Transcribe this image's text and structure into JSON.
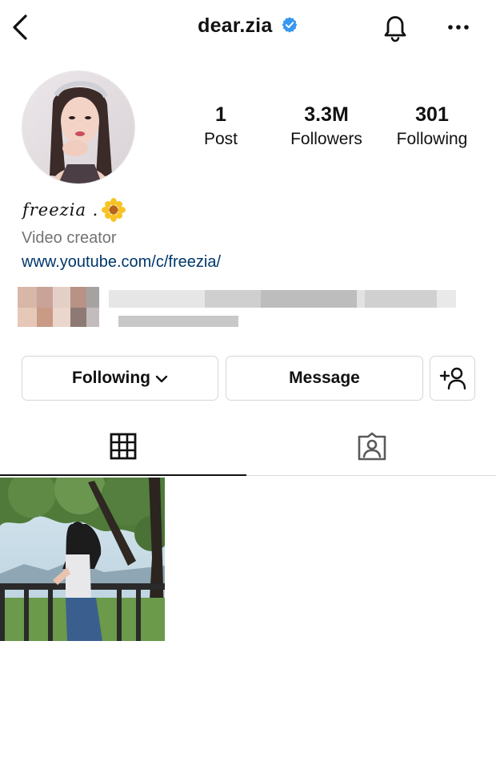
{
  "header": {
    "username": "dear.zia"
  },
  "profile": {
    "stats": {
      "posts_count": "1",
      "posts_label": "Post",
      "followers_count": "3.3M",
      "followers_label": "Followers",
      "following_count": "301",
      "following_label": "Following"
    },
    "display_name": "freezia .",
    "category": "Video creator",
    "website": "www.youtube.com/c/freezia/"
  },
  "actions": {
    "following_label": "Following",
    "message_label": "Message"
  },
  "tabs": [
    {
      "icon": "grid-icon",
      "active": true
    },
    {
      "icon": "tagged-icon",
      "active": false
    }
  ],
  "colors": {
    "verified_blue": "#3897f0",
    "link_blue": "#00376b",
    "secondary_text": "#737373",
    "border": "#d6d6d6"
  }
}
